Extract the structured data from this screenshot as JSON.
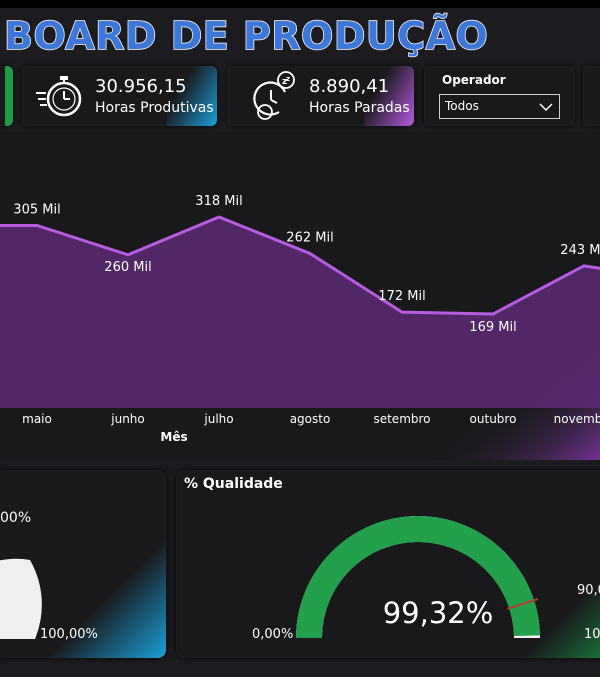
{
  "title": "BOARD DE PRODUÇÃO",
  "kpis": [
    {
      "value": "30.956,15",
      "label": "Horas Produtivas",
      "icon": "stopwatch-icon"
    },
    {
      "value": "8.890,41",
      "label": "Horas Paradas",
      "icon": "clock-sleep-icon"
    }
  ],
  "filter": {
    "title": "Operador",
    "selected": "Todos"
  },
  "colors": {
    "accent_purple": "#b65ce0",
    "area_fill": "#5c2a73",
    "gauge_green": "#22a04c",
    "cyan": "#1aa0d8"
  },
  "chart_data": {
    "type": "area",
    "xlabel": "Mês",
    "categories": [
      "maio",
      "junho",
      "julho",
      "agosto",
      "setembro",
      "outubro",
      "novembro"
    ],
    "values": [
      305,
      260,
      318,
      262,
      172,
      169,
      243
    ],
    "data_labels": [
      "305 Mil",
      "260 Mil",
      "318 Mil",
      "262 Mil",
      "172 Mil",
      "169 Mil",
      "243 Mil"
    ]
  },
  "gauge_left": {
    "top_label": "00%",
    "max_label": "100,00%"
  },
  "gauge_quality": {
    "title": "% Qualidade",
    "value_label": "99,32%",
    "value": 99.32,
    "min_label": "0,00%",
    "target_label": "90,0",
    "target": 90,
    "max_label": "10"
  }
}
